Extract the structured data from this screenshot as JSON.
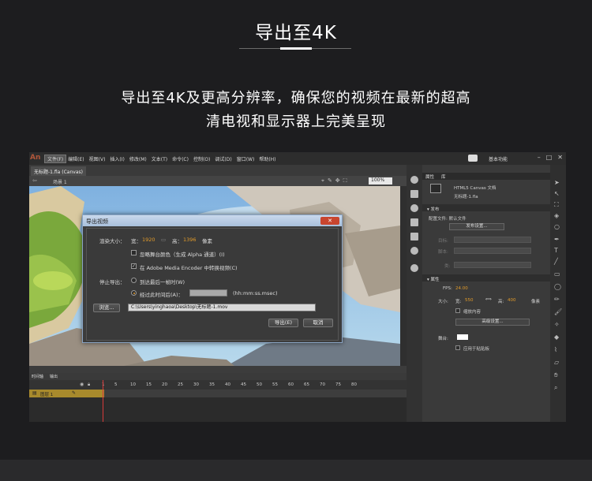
{
  "hero": {
    "title": "导出至4K",
    "subtitle_line1": "导出至4K及更高分辨率，确保您的视频在最新的超高",
    "subtitle_line2": "清电视和显示器上完美呈现"
  },
  "app": {
    "logo": "An",
    "menu": [
      "文件(F)",
      "编辑(E)",
      "视图(V)",
      "插入(I)",
      "修改(M)",
      "文本(T)",
      "命令(C)",
      "控制(O)",
      "调试(D)",
      "窗口(W)",
      "帮助(H)"
    ],
    "workspace": "基本功能",
    "document_tab": "无标题-1.fla (Canvas)",
    "scene": "场景 1",
    "zoom": "100%"
  },
  "timeline": {
    "tab_timeline": "时间轴",
    "tab_output": "输出",
    "layer_name": "图层 1",
    "frame_numbers": [
      "1",
      "5",
      "10",
      "15",
      "20",
      "25",
      "30",
      "35",
      "40",
      "45",
      "50",
      "55",
      "60",
      "65",
      "70",
      "75",
      "80"
    ]
  },
  "panel": {
    "tab_properties": "属性",
    "tab_library": "库",
    "doc_type": "HTML5 Canvas 文档",
    "file_name": "无标题-1.fla",
    "publish_header": "发布",
    "profile_label": "配置文件: 默认文件",
    "publish_settings_button": "发布设置...",
    "target_label": "目标:",
    "script_label": "脚本:",
    "class_label": "类:",
    "properties_header": "属性",
    "fps_label": "FPS:",
    "fps_value": "24.00",
    "size_label": "大小:",
    "width_label": "宽:",
    "width_value": "550",
    "height_label": "高:",
    "height_value": "400",
    "unit": "像素",
    "scale_content": "缩放内容",
    "advanced_settings_button": "高级设置...",
    "stage_label": "舞台:",
    "apply_pasteboard": "应用于粘贴板"
  },
  "dialog": {
    "title": "导出视频",
    "close_glyph": "✕",
    "render_size_label": "渲染大小：",
    "width_label": "宽：",
    "width_value": "1920",
    "height_label": "高：",
    "height_value": "1396",
    "unit": "像素",
    "ignore_stage_color": "忽略舞台颜色（生成 Alpha 通道）(I)",
    "convert_in_ame": "在 Adobe Media Encoder 中转换视频(C)",
    "stop_export_label": "停止导出：",
    "option_last_frame": "到达最后一帧时(W)",
    "option_after_time": "经过此时间后(A)：",
    "time_format": "(hh:mm:ss.msec)",
    "browse_button": "浏览...",
    "path_value": "C:\\Users\\yinghaoa\\Desktop\\无标题-1.mov",
    "export_button": "导出(E)",
    "cancel_button": "取消",
    "convert_checked": true,
    "selected_option": "after_time"
  },
  "colors": {
    "page_background": "#1d1d1f",
    "accent_orange": "#e09a2a",
    "dialog_titlebar": "#a9bfdb",
    "close_button": "#c8452f",
    "layer_highlight": "#a88a2c"
  }
}
